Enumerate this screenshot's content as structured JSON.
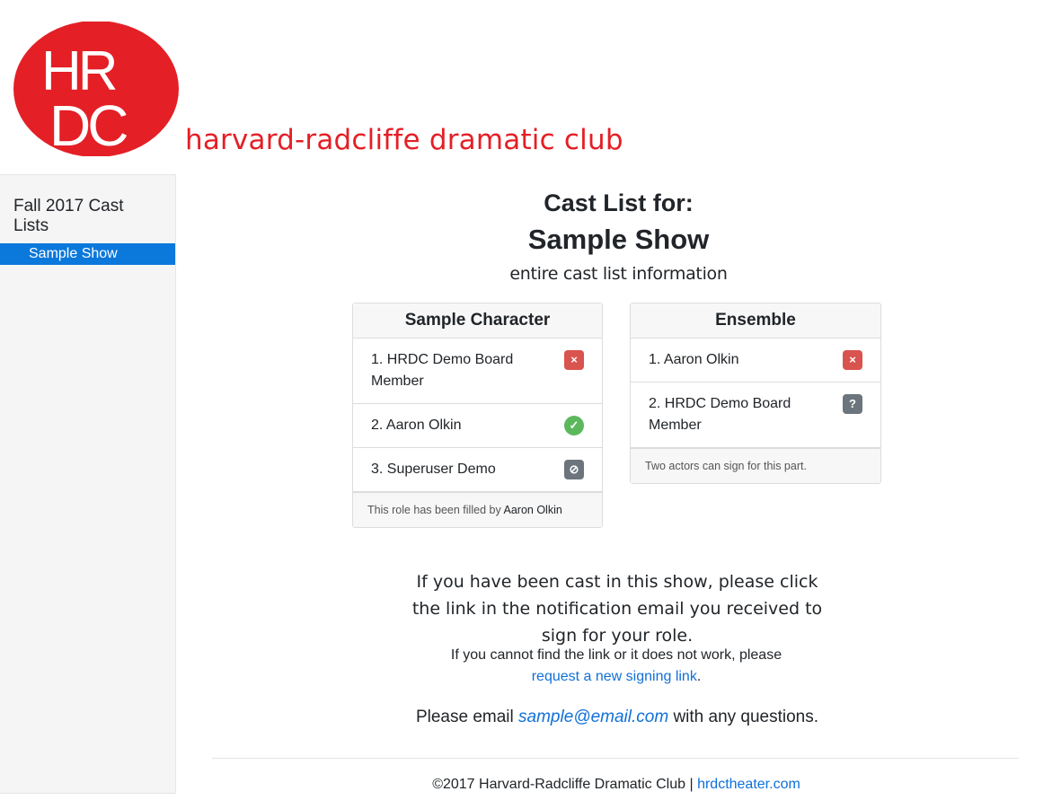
{
  "brand": {
    "logo_text": "HRDC",
    "club_name": "harvard-radcliffe dramatic club",
    "logo_color": "#e41f26"
  },
  "sidebar": {
    "heading": "Fall 2017 Cast Lists",
    "items": [
      {
        "label": "Sample Show",
        "active": true
      }
    ]
  },
  "main": {
    "title": "Cast List for:",
    "show_title": "Sample Show",
    "subtitle": "entire cast list information",
    "cards": [
      {
        "header": "Sample Character",
        "items": [
          {
            "label": "1. HRDC Demo Board Member",
            "status_icon": "close-icon",
            "status_color": "#d9534f"
          },
          {
            "label": "2. Aaron Olkin",
            "status_icon": "check-icon",
            "status_color": "#5cb85c"
          },
          {
            "label": "3. Superuser Demo",
            "status_icon": "block-icon",
            "status_color": "#6c757d"
          }
        ],
        "footer_prefix": "This role has been filled by",
        "footer_name": "Aaron Olkin"
      },
      {
        "header": "Ensemble",
        "items": [
          {
            "label": "1. Aaron Olkin",
            "status_icon": "close-icon",
            "status_color": "#d9534f"
          },
          {
            "label": "2. HRDC Demo Board Member",
            "status_icon": "question-icon",
            "status_color": "#6c757d"
          }
        ],
        "footer_text": "Two actors can sign for this part."
      }
    ],
    "info_text": "If you have been cast in this show, please click the link in the notification email you received to sign for your role.",
    "help_prefix": "If you cannot find the link or it does not work, please",
    "help_link": "request a new signing link",
    "help_suffix": ".",
    "email_prefix": "Please email",
    "email_address": "sample@email.com",
    "email_suffix": "with any questions."
  },
  "footer": {
    "text": "©2017 Harvard-Radcliffe Dramatic Club | ",
    "link": "hrdctheater.com"
  }
}
